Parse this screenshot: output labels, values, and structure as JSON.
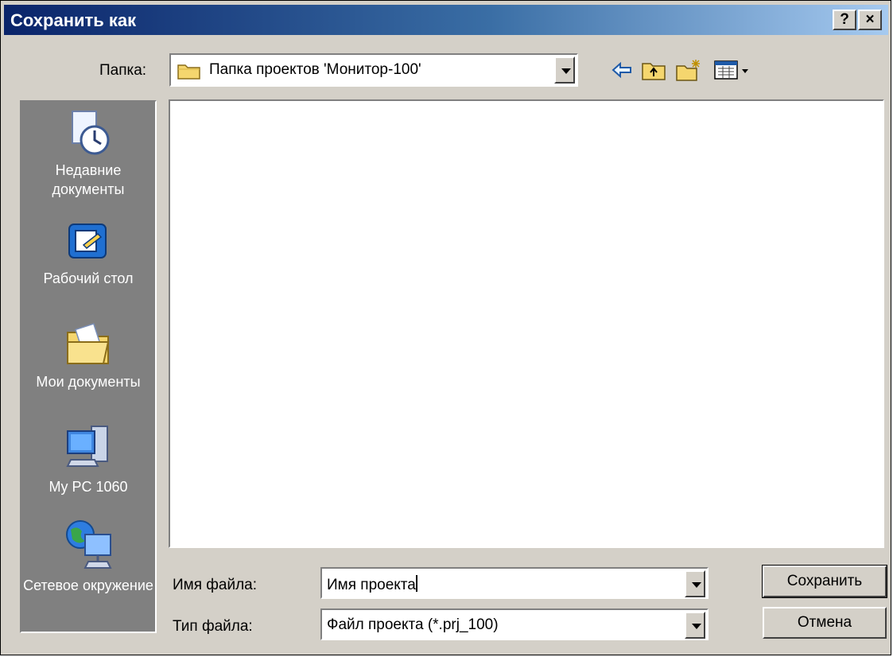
{
  "window": {
    "title": "Сохранить как",
    "help_label": "?",
    "close_label": "×"
  },
  "location": {
    "label": "Папка:",
    "current_folder": "Папка проектов 'Монитор-100'"
  },
  "toolbar": {
    "icons": [
      "back-icon",
      "up-folder-icon",
      "new-folder-icon",
      "view-menu-icon"
    ]
  },
  "places": [
    {
      "label": "Недавние документы",
      "icon": "recent-documents-icon"
    },
    {
      "label": "Рабочий стол",
      "icon": "desktop-icon"
    },
    {
      "label": "Мои документы",
      "icon": "my-documents-icon"
    },
    {
      "label": "My PC 1060",
      "icon": "my-computer-icon"
    },
    {
      "label": "Сетевое окружение",
      "icon": "network-icon"
    }
  ],
  "form": {
    "filename_label": "Имя файла:",
    "filename_value": "Имя проекта",
    "filetype_label": "Тип файла:",
    "filetype_value": "Файл проекта (*.prj_100)"
  },
  "buttons": {
    "save": "Сохранить",
    "cancel": "Отмена"
  },
  "colors": {
    "title_gradient_start": "#0a246a",
    "title_gradient_end": "#a6caf0",
    "face": "#d4d0c8",
    "places_bar": "#808080"
  }
}
